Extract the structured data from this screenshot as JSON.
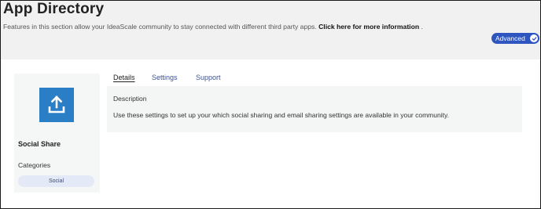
{
  "header": {
    "title": "App Directory",
    "intro_text": "Features in this section allow your IdeaScale community to stay connected with different third party apps.",
    "intro_link": "Click here for more information",
    "intro_suffix": ".",
    "advanced_label": "Advanced",
    "advanced_enabled": true
  },
  "sidebar": {
    "app_icon": "upload-share-icon",
    "app_icon_color": "#2a7ec5",
    "app_name": "Social Share",
    "categories_label": "Categories",
    "categories": [
      "Social"
    ]
  },
  "tabs": [
    {
      "label": "Details",
      "active": true
    },
    {
      "label": "Settings",
      "active": false
    },
    {
      "label": "Support",
      "active": false
    }
  ],
  "details": {
    "heading": "Description",
    "text": "Use these settings to set up your which social sharing and email sharing settings are available in your community."
  },
  "colors": {
    "accent": "#2f56c0",
    "tab_link": "#3d5494"
  }
}
